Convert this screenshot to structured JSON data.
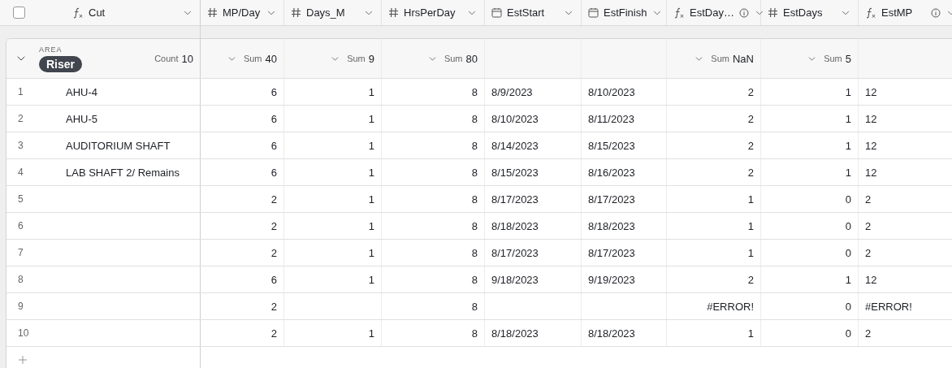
{
  "header_checkbox": {
    "checked": false
  },
  "primary_column": {
    "name": "Cut",
    "kind": "formula"
  },
  "columns": [
    {
      "name": "MP/Day",
      "kind": "number",
      "numeric": true,
      "info": false,
      "summary": {
        "label": "Sum",
        "value": "40"
      }
    },
    {
      "name": "Days_M",
      "kind": "number",
      "numeric": true,
      "info": false,
      "summary": {
        "label": "Sum",
        "value": "9"
      }
    },
    {
      "name": "HrsPerDay",
      "kind": "number",
      "numeric": true,
      "info": false,
      "summary": {
        "label": "Sum",
        "value": "80"
      }
    },
    {
      "name": "EstStart",
      "kind": "date",
      "numeric": false,
      "info": false
    },
    {
      "name": "EstFinish",
      "kind": "date",
      "numeric": false,
      "info": false
    },
    {
      "name": "EstDay…",
      "kind": "formula",
      "numeric": true,
      "info": true,
      "summary": {
        "label": "Sum",
        "value": "NaN"
      }
    },
    {
      "name": "EstDays",
      "kind": "number",
      "numeric": true,
      "info": false,
      "summary": {
        "label": "Sum",
        "value": "5"
      }
    },
    {
      "name": "EstMP",
      "kind": "formula",
      "numeric": false,
      "info": true
    }
  ],
  "group": {
    "field": "AREA",
    "value": "Riser",
    "expanded": true,
    "count_label": "Count",
    "count": "10"
  },
  "rows": [
    {
      "number": "1",
      "cut": "AHU-4",
      "cells": [
        "6",
        "1",
        "8",
        "8/9/2023",
        "8/10/2023",
        "2",
        "1",
        "12"
      ]
    },
    {
      "number": "2",
      "cut": "AHU-5",
      "cells": [
        "6",
        "1",
        "8",
        "8/10/2023",
        "8/11/2023",
        "2",
        "1",
        "12"
      ]
    },
    {
      "number": "3",
      "cut": "AUDITORIUM SHAFT",
      "cells": [
        "6",
        "1",
        "8",
        "8/14/2023",
        "8/15/2023",
        "2",
        "1",
        "12"
      ]
    },
    {
      "number": "4",
      "cut": "LAB SHAFT 2/ Remains",
      "cells": [
        "6",
        "1",
        "8",
        "8/15/2023",
        "8/16/2023",
        "2",
        "1",
        "12"
      ]
    },
    {
      "number": "5",
      "cells": [
        "2",
        "1",
        "8",
        "8/17/2023",
        "8/17/2023",
        "1",
        "0",
        "2"
      ]
    },
    {
      "number": "6",
      "cells": [
        "2",
        "1",
        "8",
        "8/18/2023",
        "8/18/2023",
        "1",
        "0",
        "2"
      ]
    },
    {
      "number": "7",
      "cells": [
        "2",
        "1",
        "8",
        "8/17/2023",
        "8/17/2023",
        "1",
        "0",
        "2"
      ]
    },
    {
      "number": "8",
      "cells": [
        "6",
        "1",
        "8",
        "9/18/2023",
        "9/19/2023",
        "2",
        "1",
        "12"
      ]
    },
    {
      "number": "9",
      "cells": [
        "2",
        null,
        "8",
        null,
        null,
        "#ERROR!",
        "0",
        "#ERROR!"
      ]
    },
    {
      "number": "10",
      "cells": [
        "2",
        "1",
        "8",
        "8/18/2023",
        "8/18/2023",
        "1",
        "0",
        "2"
      ]
    }
  ]
}
